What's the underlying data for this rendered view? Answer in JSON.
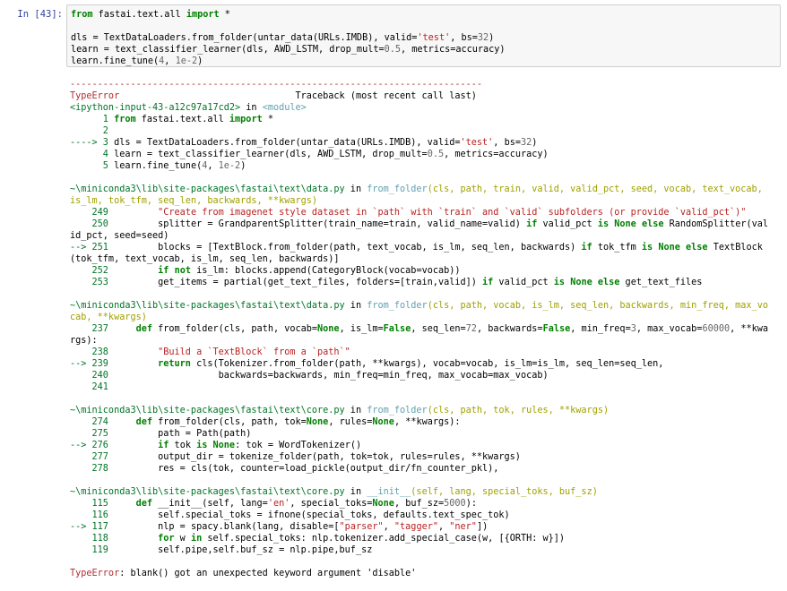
{
  "cell": {
    "prompt": "In [43]:"
  },
  "input": {
    "lines": [
      "from fastai.text.all import *",
      "",
      "dls = TextDataLoaders.from_folder(untar_data(URLs.IMDB), valid='test', bs=32)",
      "learn = text_classifier_learner(dls, AWD_LSTM, drop_mult=0.5, metrics=accuracy)",
      "learn.fine_tune(4, 1e-2)"
    ]
  },
  "traceback": {
    "separator": "---------------------------------------------------------------------------",
    "error_type": "TypeError",
    "header_right": "Traceback (most recent call last)",
    "origin_file": "<ipython-input-43-a12c97a17cd2>",
    "origin_in": " in ",
    "origin_module": "<module>",
    "frame0": [
      "      1 from fastai.text.all import *",
      "      2 ",
      "----> 3 dls = TextDataLoaders.from_folder(untar_data(URLs.IMDB), valid='test', bs=32)",
      "      4 learn = text_classifier_learner(dls, AWD_LSTM, drop_mult=0.5, metrics=accuracy)",
      "      5 learn.fine_tune(4, 1e-2)"
    ],
    "frame1_header": [
      "~\\miniconda3\\lib\\site-packages\\fastai\\text\\data.py in from_folder(cls, path, train, valid, valid_pct, seed, vocab, text_vocab,",
      "is_lm, tok_tfm, seq_len, backwards, **kwargs)"
    ],
    "frame1": [
      "    249         \"Create from imagenet style dataset in `path` with `train` and `valid` subfolders (or provide `valid_pct`)\"",
      "    250         splitter = GrandparentSplitter(train_name=train, valid_name=valid) if valid_pct is None else RandomSplitter(val",
      "id_pct, seed=seed)",
      "--> 251         blocks = [TextBlock.from_folder(path, text_vocab, is_lm, seq_len, backwards) if tok_tfm is None else TextBlock",
      "(tok_tfm, text_vocab, is_lm, seq_len, backwards)]",
      "    252         if not is_lm: blocks.append(CategoryBlock(vocab=vocab))",
      "    253         get_items = partial(get_text_files, folders=[train,valid]) if valid_pct is None else get_text_files"
    ],
    "frame2_header": [
      "~\\miniconda3\\lib\\site-packages\\fastai\\text\\data.py in from_folder(cls, path, vocab, is_lm, seq_len, backwards, min_freq, max_vo",
      "cab, **kwargs)"
    ],
    "frame2": [
      "    237     def from_folder(cls, path, vocab=None, is_lm=False, seq_len=72, backwards=False, min_freq=3, max_vocab=60000, **kwa",
      "rgs):",
      "    238         \"Build a `TextBlock` from a `path`\"",
      "--> 239         return cls(Tokenizer.from_folder(path, **kwargs), vocab=vocab, is_lm=is_lm, seq_len=seq_len,",
      "    240                    backwards=backwards, min_freq=min_freq, max_vocab=max_vocab)",
      "    241 "
    ],
    "frame3_header": "~\\miniconda3\\lib\\site-packages\\fastai\\text\\core.py in from_folder(cls, path, tok, rules, **kwargs)",
    "frame3": [
      "    274     def from_folder(cls, path, tok=None, rules=None, **kwargs):",
      "    275         path = Path(path)",
      "--> 276         if tok is None: tok = WordTokenizer()",
      "    277         output_dir = tokenize_folder(path, tok=tok, rules=rules, **kwargs)",
      "    278         res = cls(tok, counter=load_pickle(output_dir/fn_counter_pkl),"
    ],
    "frame4_header": "~\\miniconda3\\lib\\site-packages\\fastai\\text\\core.py in __init__(self, lang, special_toks, buf_sz)",
    "frame4": [
      "    115     def __init__(self, lang='en', special_toks=None, buf_sz=5000):",
      "    116         self.special_toks = ifnone(special_toks, defaults.text_spec_tok)",
      "--> 117         nlp = spacy.blank(lang, disable=[\"parser\", \"tagger\", \"ner\"])",
      "    118         for w in self.special_toks: nlp.tokenizer.add_special_case(w, [{ORTH: w}])",
      "    119         self.pipe,self.buf_sz = nlp.pipe,buf_sz"
    ],
    "final_error": "TypeError: blank() got an unexpected keyword argument 'disable'"
  },
  "colors": {
    "prompt": "#303f9f",
    "cell_bg": "#f7f7f7",
    "error_red": "#b22b31",
    "lineno_green": "#007427",
    "func_cyan": "#60a0b0",
    "keyword_green": "#008000"
  }
}
